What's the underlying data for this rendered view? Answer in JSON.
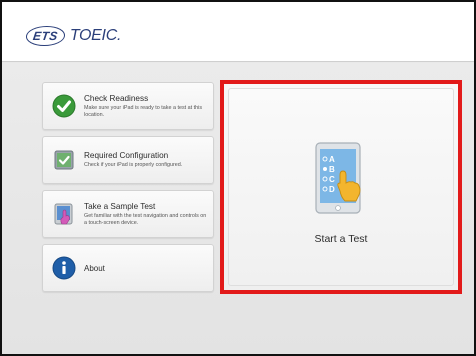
{
  "header": {
    "logo_ets": "ETS",
    "logo_product": "TOEIC."
  },
  "menu": {
    "items": [
      {
        "title": "Check Readiness",
        "description": "Make sure your iPad is ready to take a test at this location.",
        "icon": "checkmark-icon"
      },
      {
        "title": "Required Configuration",
        "description": "Check if your iPad is properly configured.",
        "icon": "configuration-icon"
      },
      {
        "title": "Take a Sample Test",
        "description": "Get familiar with the test navigation and controls on a touch-screen device.",
        "icon": "sample-test-icon"
      },
      {
        "title": "About",
        "description": "",
        "icon": "info-icon"
      }
    ]
  },
  "start_test": {
    "label": "Start a Test",
    "options": [
      "A",
      "B",
      "C",
      "D"
    ],
    "icon": "tablet-answer-icon"
  },
  "colors": {
    "highlight_border": "#e21a1a",
    "check_green": "#3a9a3a",
    "info_blue": "#1f5ea8",
    "brand_navy": "#2b3f7a"
  }
}
